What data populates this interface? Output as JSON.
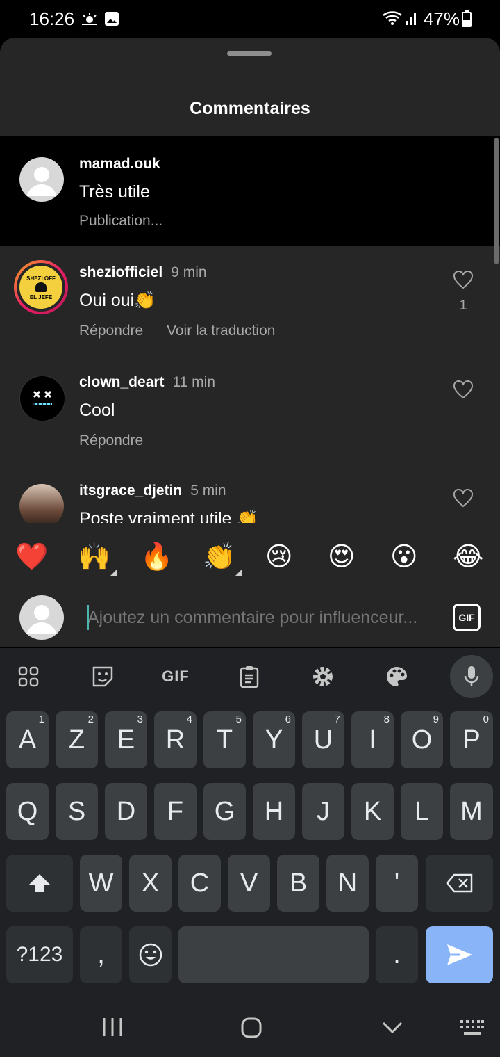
{
  "status_bar": {
    "time": "16:26",
    "battery": "47%"
  },
  "sheet": {
    "title": "Commentaires"
  },
  "pending_comment": {
    "username": "mamad.ouk",
    "text": "Très utile",
    "status": "Publication..."
  },
  "comments": [
    {
      "username": "sheziofficiel",
      "time": "9 min",
      "text": "Oui oui👏",
      "reply": "Répondre",
      "translate": "Voir la traduction",
      "likes": "1",
      "avatar_label_top": "SHEZI OFF",
      "avatar_label_bottom": "EL JEFE"
    },
    {
      "username": "clown_deart",
      "time": "11 min",
      "text": "Cool",
      "reply": "Répondre"
    },
    {
      "username": "itsgrace_djetin",
      "time": "5 min",
      "text": "Poste vraiment utile 👏"
    }
  ],
  "quick_reactions": [
    "❤️",
    "🙌",
    "🔥",
    "👏",
    "😢",
    "😍",
    "😮",
    "😂"
  ],
  "input": {
    "placeholder": "Ajoutez un commentaire pour influenceur...",
    "gif_label": "GIF"
  },
  "keyboard": {
    "toolbar_gif": "GIF",
    "row1": [
      {
        "key": "A",
        "hint": "1"
      },
      {
        "key": "Z",
        "hint": "2"
      },
      {
        "key": "E",
        "hint": "3"
      },
      {
        "key": "R",
        "hint": "4"
      },
      {
        "key": "T",
        "hint": "5"
      },
      {
        "key": "Y",
        "hint": "6"
      },
      {
        "key": "U",
        "hint": "7"
      },
      {
        "key": "I",
        "hint": "8"
      },
      {
        "key": "O",
        "hint": "9"
      },
      {
        "key": "P",
        "hint": "0"
      }
    ],
    "row2": [
      "Q",
      "S",
      "D",
      "F",
      "G",
      "H",
      "J",
      "K",
      "L",
      "M"
    ],
    "row3": [
      "W",
      "X",
      "C",
      "V",
      "B",
      "N",
      "'"
    ],
    "row4": {
      "symbols": "?123",
      "comma": ",",
      "period": "."
    }
  },
  "colors": {
    "sheet_bg": "#262626",
    "highlight_bg": "#000000",
    "keyboard_bg": "#202124",
    "key_bg": "#3c4043",
    "enter_key": "#8ab4f8",
    "story_ring_start": "#f9a825",
    "story_ring_end": "#c2185b"
  }
}
